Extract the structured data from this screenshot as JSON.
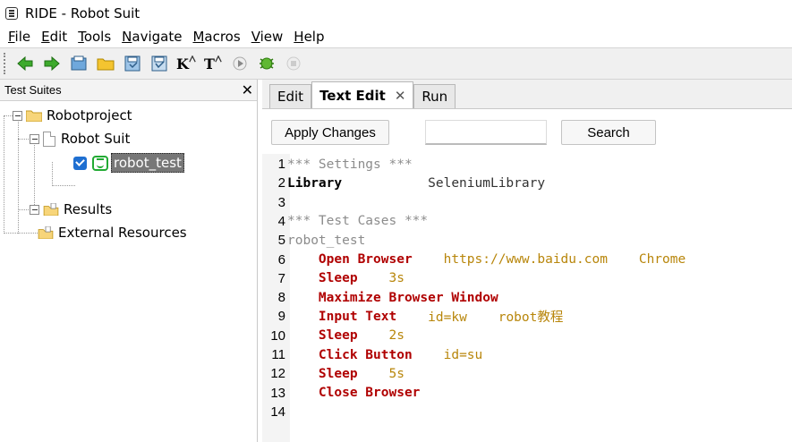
{
  "window": {
    "title": "RIDE - Robot Suit"
  },
  "menu": [
    {
      "label": "File",
      "u": "F",
      "rest": "ile"
    },
    {
      "label": "Edit",
      "u": "E",
      "rest": "dit"
    },
    {
      "label": "Tools",
      "u": "T",
      "rest": "ools"
    },
    {
      "label": "Navigate",
      "u": "N",
      "rest": "avigate"
    },
    {
      "label": "Macros",
      "u": "M",
      "rest": "acros"
    },
    {
      "label": "View",
      "u": "V",
      "rest": "iew"
    },
    {
      "label": "Help",
      "u": "H",
      "rest": "elp"
    }
  ],
  "toolbar": {
    "icons": [
      "back-arrow-icon",
      "forward-arrow-icon",
      "open-suite-icon",
      "open-directory-icon",
      "save-icon",
      "save-all-icon",
      "search-keywords-icon",
      "search-tests-icon",
      "run-icon",
      "debug-icon",
      "stop-icon"
    ],
    "keyword_text": "K",
    "test_text": "T"
  },
  "left": {
    "header": "Test Suites",
    "close": "✕",
    "tree": {
      "project": "Robotproject",
      "suite": "Robot Suit",
      "test": "robot_test",
      "results": "Results",
      "external": "External Resources"
    }
  },
  "tabs": [
    {
      "label": "Edit"
    },
    {
      "label": "Text Edit",
      "close": "✕"
    },
    {
      "label": "Run"
    }
  ],
  "actions": {
    "apply": "Apply Changes",
    "search": "Search",
    "search_value": ""
  },
  "code": {
    "lines": [
      {
        "n": "1",
        "parts": [
          {
            "t": "*** Settings ***",
            "c": "c-header"
          }
        ]
      },
      {
        "n": "2",
        "parts": [
          {
            "t": "Library",
            "c": "c-setting"
          },
          {
            "t": "           SeleniumLibrary",
            "c": "c-arg-plain"
          }
        ]
      },
      {
        "n": "3",
        "parts": []
      },
      {
        "n": "4",
        "parts": [
          {
            "t": "*** Test Cases ***",
            "c": "c-header"
          }
        ]
      },
      {
        "n": "5",
        "parts": [
          {
            "t": "robot_test",
            "c": "c-tc"
          }
        ]
      },
      {
        "n": "6",
        "parts": [
          {
            "t": "    ",
            "c": ""
          },
          {
            "t": "Open Browser",
            "c": "c-kw"
          },
          {
            "t": "    https://www.baidu.com    Chrome",
            "c": "c-arg"
          }
        ]
      },
      {
        "n": "7",
        "parts": [
          {
            "t": "    ",
            "c": ""
          },
          {
            "t": "Sleep",
            "c": "c-kw"
          },
          {
            "t": "    3s",
            "c": "c-arg"
          }
        ]
      },
      {
        "n": "8",
        "parts": [
          {
            "t": "    ",
            "c": ""
          },
          {
            "t": "Maximize Browser Window",
            "c": "c-kw"
          }
        ]
      },
      {
        "n": "9",
        "parts": [
          {
            "t": "    ",
            "c": ""
          },
          {
            "t": "Input Text",
            "c": "c-kw"
          },
          {
            "t": "    id=kw    robot教程",
            "c": "c-arg"
          }
        ]
      },
      {
        "n": "10",
        "parts": [
          {
            "t": "    ",
            "c": ""
          },
          {
            "t": "Sleep",
            "c": "c-kw"
          },
          {
            "t": "    2s",
            "c": "c-arg"
          }
        ]
      },
      {
        "n": "11",
        "parts": [
          {
            "t": "    ",
            "c": ""
          },
          {
            "t": "Click Button",
            "c": "c-kw"
          },
          {
            "t": "    id=su",
            "c": "c-arg"
          }
        ]
      },
      {
        "n": "12",
        "parts": [
          {
            "t": "    ",
            "c": ""
          },
          {
            "t": "Sleep",
            "c": "c-kw"
          },
          {
            "t": "    5s",
            "c": "c-arg"
          }
        ]
      },
      {
        "n": "13",
        "parts": [
          {
            "t": "    ",
            "c": ""
          },
          {
            "t": "Close Browser",
            "c": "c-kw"
          }
        ]
      },
      {
        "n": "14",
        "parts": []
      }
    ]
  },
  "colors": {
    "keyword": "#b00000",
    "argument": "#b8860b",
    "header": "#8c8c8c",
    "selection": "#777777",
    "check": "#1f6fd1",
    "robot": "#22aa33"
  }
}
